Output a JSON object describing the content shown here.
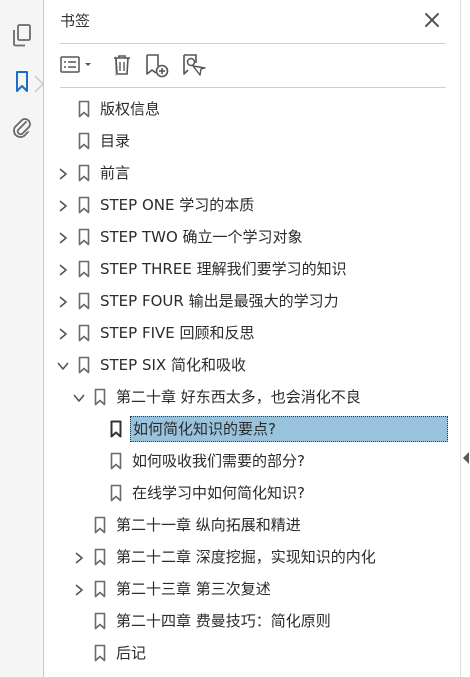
{
  "panel": {
    "title": "书签",
    "close_icon": "close-icon"
  },
  "rail": {
    "icons": [
      "pages-icon",
      "bookmark-icon",
      "attachment-icon"
    ],
    "active": "bookmark-icon"
  },
  "toolbar": {
    "icons": [
      "options-menu-icon",
      "delete-icon",
      "new-bookmark-icon",
      "bookmark-search-icon"
    ]
  },
  "bookmarks": [
    {
      "label": "版权信息",
      "expandable": false,
      "expanded": false,
      "selected": false,
      "level": 0
    },
    {
      "label": "目录",
      "expandable": false,
      "expanded": false,
      "selected": false,
      "level": 0
    },
    {
      "label": "前言",
      "expandable": true,
      "expanded": false,
      "selected": false,
      "level": 0
    },
    {
      "label": "STEP ONE 学习的本质",
      "expandable": true,
      "expanded": false,
      "selected": false,
      "level": 0
    },
    {
      "label": "STEP TWO 确立一个学习对象",
      "expandable": true,
      "expanded": false,
      "selected": false,
      "level": 0
    },
    {
      "label": "STEP THREE 理解我们要学习的知识",
      "expandable": true,
      "expanded": false,
      "selected": false,
      "level": 0
    },
    {
      "label": "STEP FOUR 输出是最强大的学习力",
      "expandable": true,
      "expanded": false,
      "selected": false,
      "level": 0
    },
    {
      "label": "STEP FIVE 回顾和反思",
      "expandable": true,
      "expanded": false,
      "selected": false,
      "level": 0
    },
    {
      "label": "STEP SIX 简化和吸收",
      "expandable": true,
      "expanded": true,
      "selected": false,
      "level": 0
    },
    {
      "label": "第二十章 好东西太多，也会消化不良",
      "expandable": true,
      "expanded": true,
      "selected": false,
      "level": 1
    },
    {
      "label": "如何简化知识的要点?",
      "expandable": false,
      "expanded": false,
      "selected": true,
      "level": 2
    },
    {
      "label": "如何吸收我们需要的部分?",
      "expandable": false,
      "expanded": false,
      "selected": false,
      "level": 2
    },
    {
      "label": "在线学习中如何简化知识?",
      "expandable": false,
      "expanded": false,
      "selected": false,
      "level": 2
    },
    {
      "label": "第二十一章 纵向拓展和精进",
      "expandable": false,
      "expanded": false,
      "selected": false,
      "level": 1
    },
    {
      "label": "第二十二章 深度挖掘，实现知识的内化",
      "expandable": true,
      "expanded": false,
      "selected": false,
      "level": 1
    },
    {
      "label": "第二十三章 第三次复述",
      "expandable": true,
      "expanded": false,
      "selected": false,
      "level": 1
    },
    {
      "label": "第二十四章 费曼技巧：简化原则",
      "expandable": false,
      "expanded": false,
      "selected": false,
      "level": 1
    },
    {
      "label": "后记",
      "expandable": false,
      "expanded": false,
      "selected": false,
      "level": 1
    }
  ],
  "colors": {
    "selection": "#99c2dd",
    "icon": "#6a6a6a",
    "rail_active": "#1a6fc4"
  }
}
